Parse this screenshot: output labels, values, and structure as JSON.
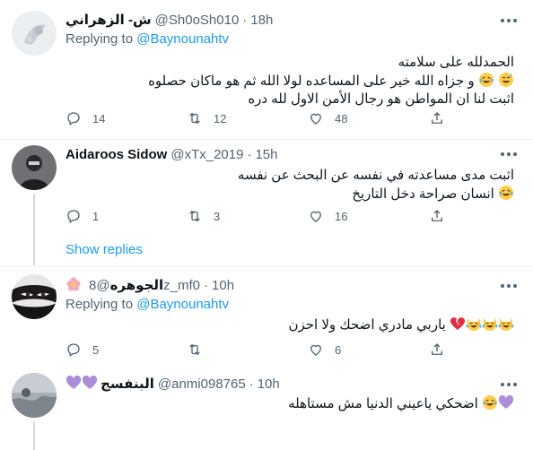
{
  "tweets": [
    {
      "name": "ش- الزهراني",
      "handle": "@Sh0oSh010",
      "dot": "·",
      "time": "18h",
      "replying_prefix": "Replying to ",
      "replying_to": "@Baynounahtv",
      "lines": [
        "الحمدلله على سلامته",
        "و جزاه الله خير على المساعده لولا الله ثم هو ماكان حصلوه",
        "اثبت لنا ان المواطن هو رجال الأمن الاول لله دره"
      ],
      "replies": "14",
      "retweets": "12",
      "likes": "48"
    },
    {
      "name": "Aidaroos Sidow",
      "handle": "@xTx_2019",
      "dot": "·",
      "time": "15h",
      "lines": [
        "اثبت مدى مساعدته في نفسه عن البحث عن نفسه",
        "انسان صراحة دخل التاريخ"
      ],
      "replies": "1",
      "retweets": "3",
      "likes": "16"
    },
    {
      "name": "الجوهره",
      "handle": "@8z_mf0",
      "dot": "·",
      "time": "10h",
      "replying_prefix": "Replying to ",
      "replying_to": "@Baynounahtv",
      "lines": [
        "ياربي   مادري اضحك ولا احزن"
      ],
      "replies": "5",
      "retweets": "",
      "likes": "6"
    },
    {
      "name": "البنفسج",
      "handle": "@anmi098765",
      "dot": "·",
      "time": "10h",
      "lines": [
        "اضحكي ياعيني الدنيا مش مستاهله"
      ]
    }
  ],
  "show_replies": "Show replies",
  "colors": {
    "accent": "#1d9bf0",
    "muted": "#536471",
    "text": "#0f1419",
    "divider": "#eff3f4"
  }
}
